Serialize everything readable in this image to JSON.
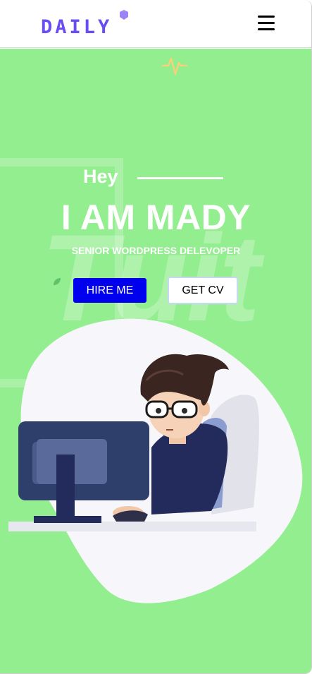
{
  "header": {
    "logo_text": "DAILY",
    "menu_icon": "hamburger-menu-icon"
  },
  "hero": {
    "background_word": "Tuit",
    "greeting": "Hey",
    "name": "I AM MADY",
    "role": "SENIOR WORDPRESS DELEVOPER",
    "hire_label": "HIRE ME",
    "cv_label": "GET CV"
  },
  "icons": {
    "pulse": "heartbeat-icon",
    "leaf": "leaf-icon",
    "illustration": "developer-at-computer-illustration"
  },
  "colors": {
    "hero_bg": "#93ee8f",
    "accent": "#6a4cf5",
    "hire_button": "#0000ee",
    "blob": "#f6f6fb"
  }
}
